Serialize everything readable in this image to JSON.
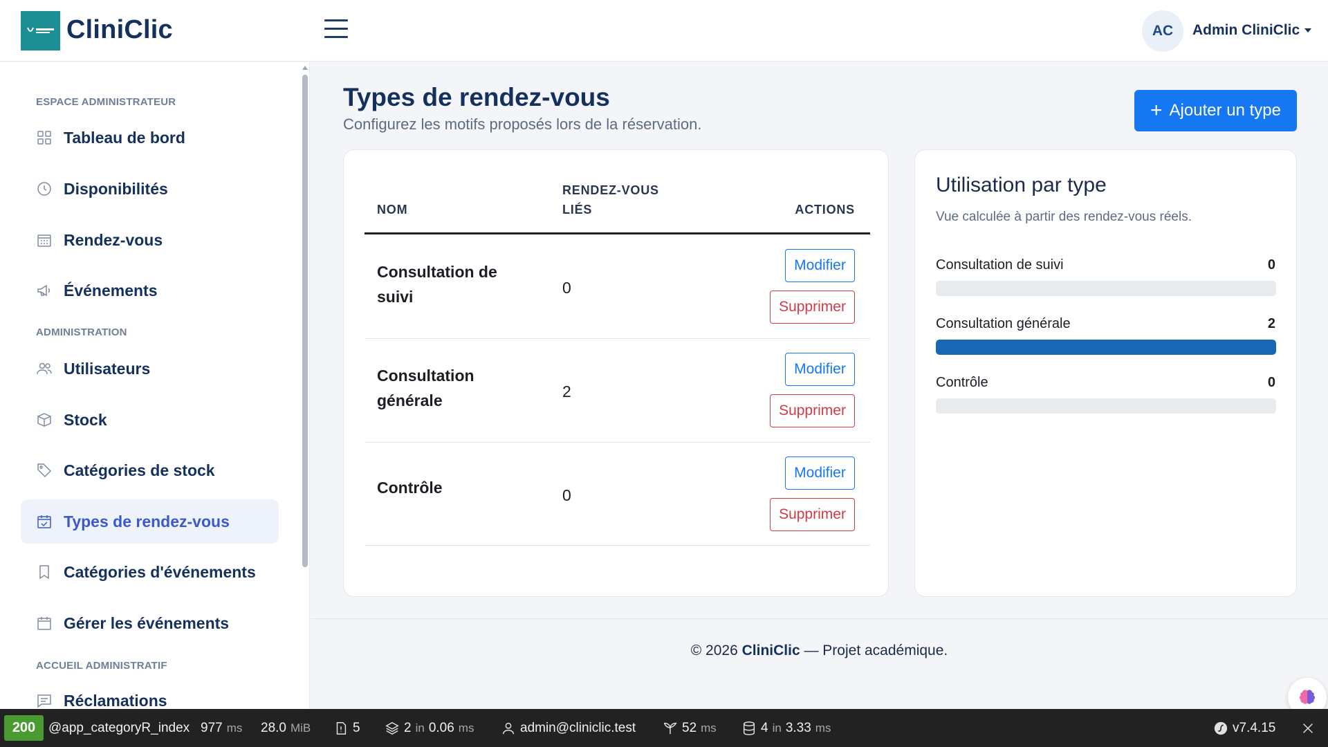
{
  "header": {
    "brand": "CliniClic",
    "user_initials": "AC",
    "user_name": "Admin CliniClic"
  },
  "sidebar": {
    "sections": [
      {
        "title": "ESPACE ADMINISTRATEUR"
      },
      {
        "title": "ADMINISTRATION"
      },
      {
        "title": "ACCUEIL ADMINISTRATIF"
      }
    ],
    "items": [
      {
        "label": "Tableau de bord",
        "icon": "grid-icon"
      },
      {
        "label": "Disponibilités",
        "icon": "clock-icon"
      },
      {
        "label": "Rendez-vous",
        "icon": "calendar-grid-icon"
      },
      {
        "label": "Événements",
        "icon": "megaphone-icon"
      },
      {
        "label": "Utilisateurs",
        "icon": "users-icon"
      },
      {
        "label": "Stock",
        "icon": "box-icon"
      },
      {
        "label": "Catégories de stock",
        "icon": "tag-icon"
      },
      {
        "label": "Types de rendez-vous",
        "icon": "calendar-check-icon",
        "active": true
      },
      {
        "label": "Catégories d'événements",
        "icon": "bookmark-icon"
      },
      {
        "label": "Gérer les événements",
        "icon": "calendar-icon"
      },
      {
        "label": "Réclamations",
        "icon": "message-icon"
      }
    ]
  },
  "main": {
    "title": "Types de rendez-vous",
    "subtitle": "Configurez les motifs proposés lors de la réservation.",
    "add_button": "Ajouter un type",
    "table": {
      "headers": {
        "name": "NOM",
        "count_line1": "RENDEZ-VOUS",
        "count_line2": "LIÉS",
        "actions": "ACTIONS"
      },
      "rows": [
        {
          "name": "Consultation de suivi",
          "count": "0",
          "edit": "Modifier",
          "delete": "Supprimer"
        },
        {
          "name": "Consultation générale",
          "count": "2",
          "edit": "Modifier",
          "delete": "Supprimer"
        },
        {
          "name": "Contrôle",
          "count": "0",
          "edit": "Modifier",
          "delete": "Supprimer"
        }
      ]
    },
    "usage": {
      "title": "Utilisation par type",
      "subtitle": "Vue calculée à partir des rendez-vous réels.",
      "items": [
        {
          "label": "Consultation de suivi",
          "value": "0",
          "fraction": 0
        },
        {
          "label": "Consultation générale",
          "value": "2",
          "fraction": 1
        },
        {
          "label": "Contrôle",
          "value": "0",
          "fraction": 0
        }
      ]
    }
  },
  "footer": {
    "prefix": "© 2026 ",
    "brand": "CliniClic",
    "suffix": " — Projet académique."
  },
  "debug": {
    "status": "200",
    "route": "@app_categoryR_index",
    "time": "977",
    "time_unit": "ms",
    "memory": "28.0",
    "memory_unit": "MiB",
    "logs": "5",
    "cache": "2",
    "cache_in": "in",
    "cache_time": "0.06",
    "cache_unit": "ms",
    "user": "admin@cliniclic.test",
    "twig": "52",
    "twig_unit": "ms",
    "db": "4",
    "db_in": "in",
    "db_time": "3.33",
    "db_unit": "ms",
    "version": "v7.4.15"
  },
  "colors": {
    "primary": "#1677f2",
    "danger": "#d13a46",
    "brand_dark": "#14315e",
    "active": "#3b59c9",
    "progress": "#1866b4"
  }
}
